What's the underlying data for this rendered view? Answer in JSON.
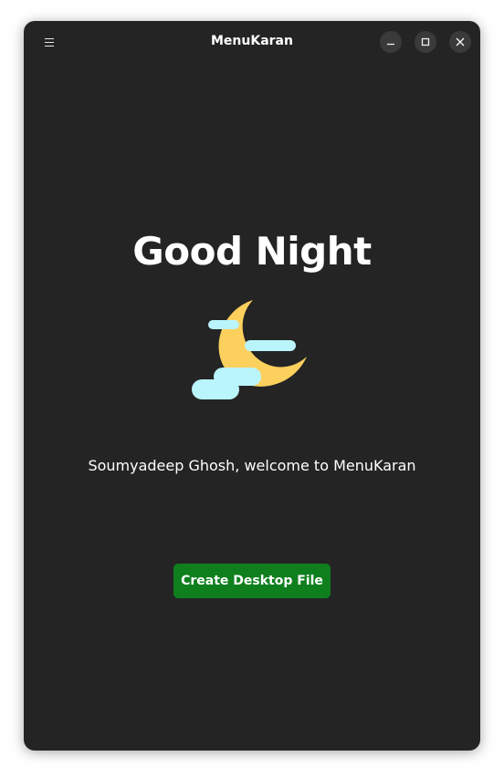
{
  "window": {
    "title": "MenuKaran"
  },
  "headerbar": {
    "menu_icon": "hamburger-icon",
    "minimize_icon": "minimize-icon",
    "maximize_icon": "maximize-icon",
    "close_icon": "close-icon"
  },
  "main": {
    "greeting": "Good Night",
    "illustration_icon": "moon-with-clouds-icon",
    "welcome_text": "Soumyadeep Ghosh, welcome to MenuKaran",
    "create_button_label": "Create Desktop File"
  },
  "colors": {
    "window_bg": "#242424",
    "button_accent": "#0f7f1e",
    "moon": "#fcd05d",
    "clouds": "#baf5fc"
  }
}
